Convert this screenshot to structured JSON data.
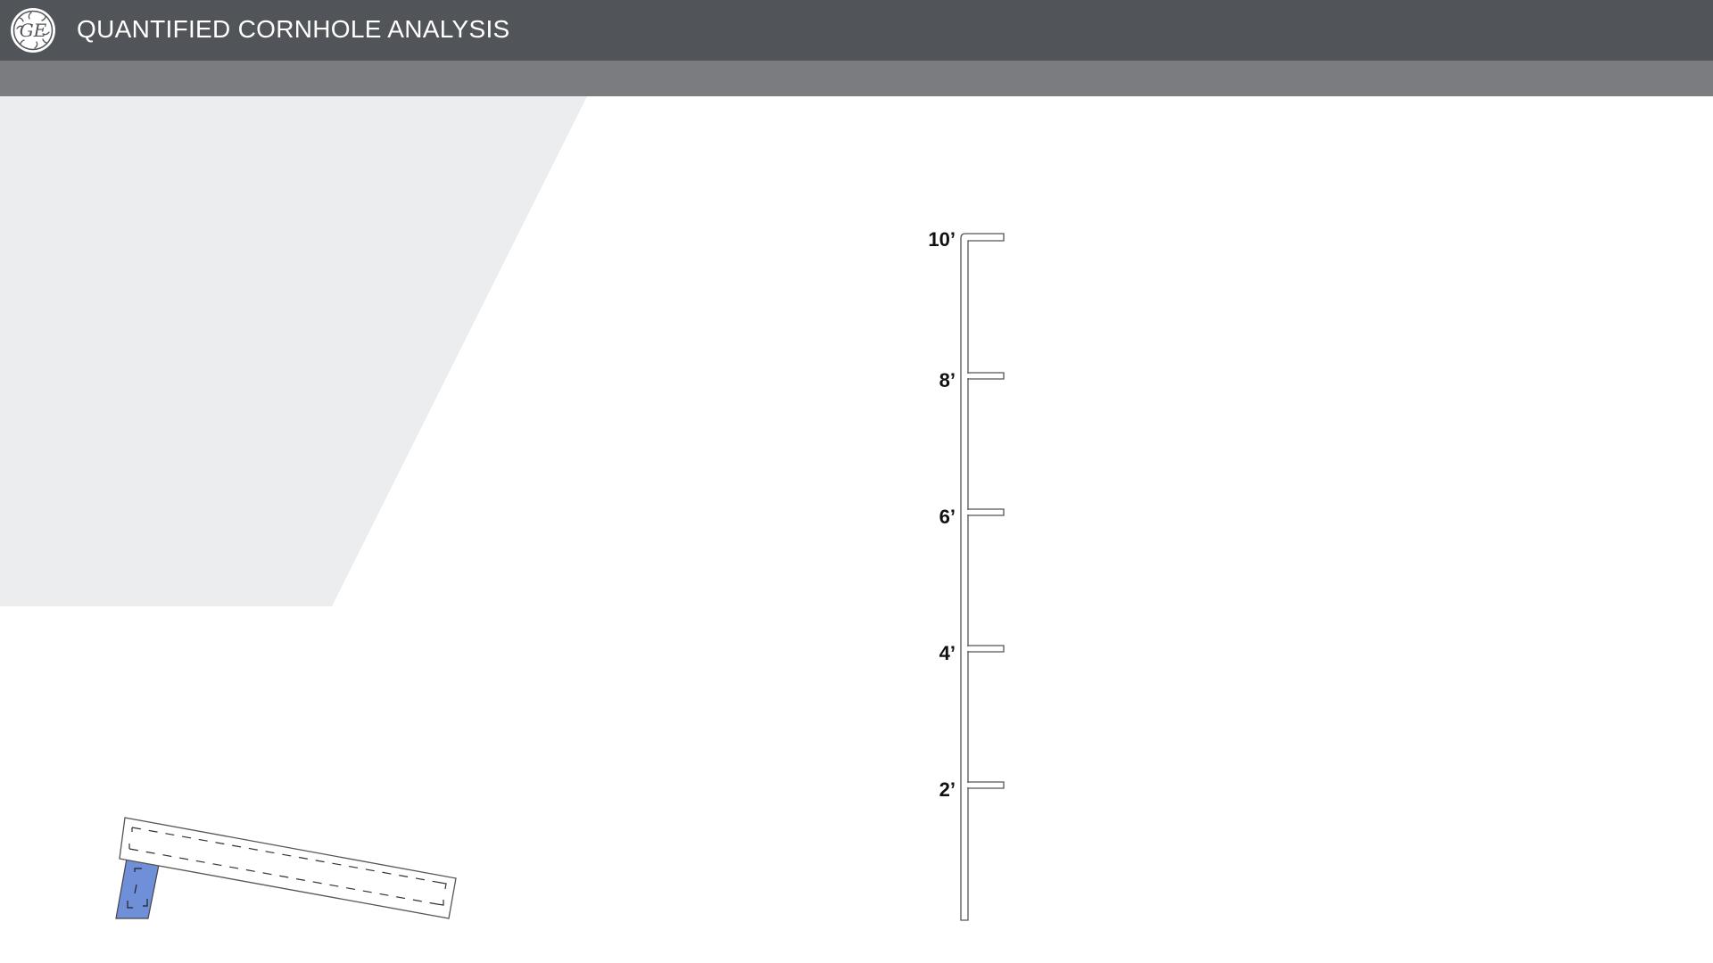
{
  "header": {
    "title": "QUANTIFIED CORNHOLE ANALYSIS",
    "logo_icon": "ge-monogram-logo"
  },
  "colors": {
    "header_bg": "#515459",
    "subbar_bg": "#7b7c7f",
    "panel_bg": "#ecedee",
    "board_leg": "#6f8fd8",
    "outline": "#555555"
  },
  "height_scale": {
    "unit": "ft",
    "ticks": [
      {
        "value": 10,
        "label": "10’"
      },
      {
        "value": 8,
        "label": "8’"
      },
      {
        "value": 6,
        "label": "6’"
      },
      {
        "value": 4,
        "label": "4’"
      },
      {
        "value": 2,
        "label": "2’"
      }
    ]
  },
  "board": {
    "icon": "cornhole-board-icon"
  }
}
